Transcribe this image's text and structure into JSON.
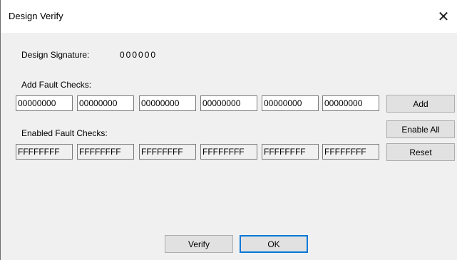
{
  "window": {
    "title": "Design Verify",
    "close_glyph": "✕"
  },
  "signature": {
    "label": "Design Signature:",
    "value": "000000"
  },
  "add_checks": {
    "label": "Add Fault Checks:",
    "values": [
      "00000000",
      "00000000",
      "00000000",
      "00000000",
      "00000000",
      "00000000"
    ]
  },
  "enabled_checks": {
    "label": "Enabled Fault Checks:",
    "values": [
      "FFFFFFFF",
      "FFFFFFFF",
      "FFFFFFFF",
      "FFFFFFFF",
      "FFFFFFFF",
      "FFFFFFFF"
    ]
  },
  "buttons": {
    "add": "Add",
    "enable_all": "Enable All",
    "reset": "Reset",
    "verify": "Verify",
    "ok": "OK"
  }
}
